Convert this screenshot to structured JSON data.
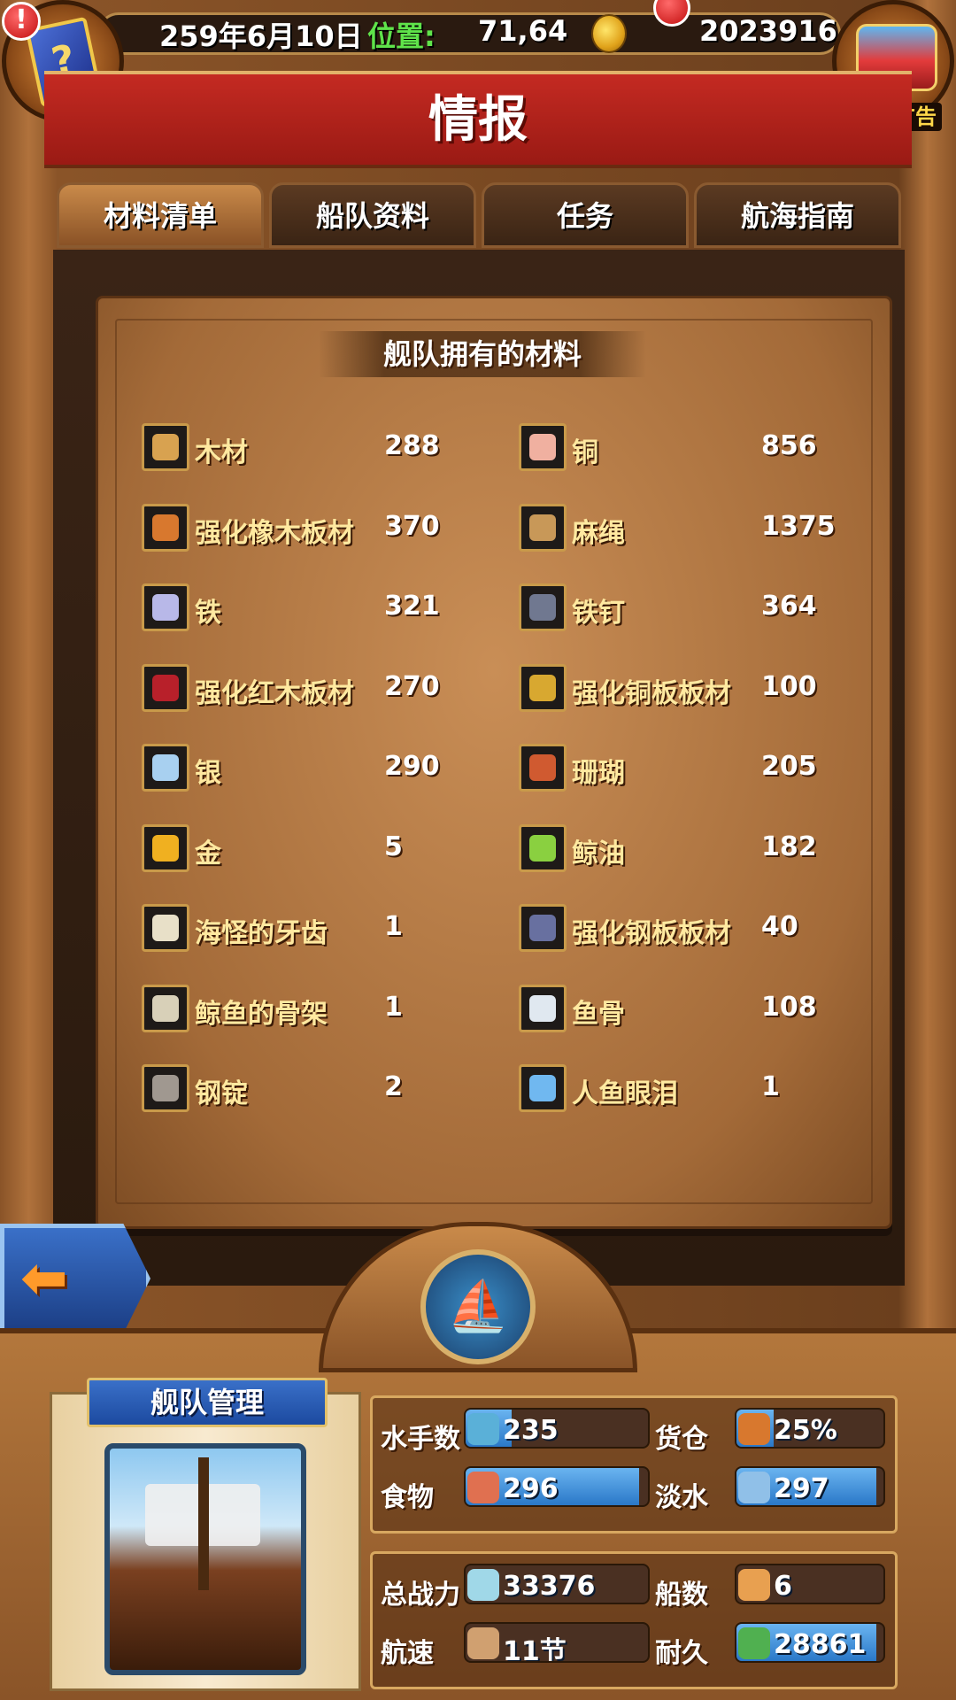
{
  "header": {
    "date": "259年6月10日",
    "position_label": "位置:",
    "position_value": "71,64",
    "gold": "2023916",
    "ad_label": "有新广告"
  },
  "title": "情报",
  "tabs": [
    {
      "label": "材料清单",
      "active": true
    },
    {
      "label": "船队资料",
      "active": false
    },
    {
      "label": "任务",
      "active": false,
      "notification": true
    },
    {
      "label": "航海指南",
      "active": false
    }
  ],
  "section_title": "舰队拥有的材料",
  "materials_left": [
    {
      "name": "木材",
      "qty": "288",
      "icon": "wood-icon",
      "color": "#d8a250"
    },
    {
      "name": "强化橡木板材",
      "qty": "370",
      "icon": "oak-plank-icon",
      "color": "#d8782e"
    },
    {
      "name": "铁",
      "qty": "321",
      "icon": "iron-icon",
      "color": "#b8b8e8"
    },
    {
      "name": "强化红木板材",
      "qty": "270",
      "icon": "mahogany-plank-icon",
      "color": "#b8202a"
    },
    {
      "name": "银",
      "qty": "290",
      "icon": "silver-icon",
      "color": "#a8d0f0"
    },
    {
      "name": "金",
      "qty": "5",
      "icon": "gold-icon",
      "color": "#f0b020"
    },
    {
      "name": "海怪的牙齿",
      "qty": "1",
      "icon": "sea-monster-tooth-icon",
      "color": "#e8e0c8"
    },
    {
      "name": "鲸鱼的骨架",
      "qty": "1",
      "icon": "whale-skeleton-icon",
      "color": "#d8d0b8"
    },
    {
      "name": "钢锭",
      "qty": "2",
      "icon": "steel-ingot-icon",
      "color": "#a09890"
    }
  ],
  "materials_right": [
    {
      "name": "铜",
      "qty": "856",
      "icon": "copper-icon",
      "color": "#f0b0a0"
    },
    {
      "name": "麻绳",
      "qty": "1375",
      "icon": "rope-icon",
      "color": "#c89858"
    },
    {
      "name": "铁钉",
      "qty": "364",
      "icon": "iron-nail-icon",
      "color": "#707890"
    },
    {
      "name": "强化铜板板材",
      "qty": "100",
      "icon": "copper-plate-icon",
      "color": "#d8a830"
    },
    {
      "name": "珊瑚",
      "qty": "205",
      "icon": "coral-icon",
      "color": "#d05a30"
    },
    {
      "name": "鲸油",
      "qty": "182",
      "icon": "whale-oil-icon",
      "color": "#8ad040"
    },
    {
      "name": "强化钢板板材",
      "qty": "40",
      "icon": "steel-plate-icon",
      "color": "#6870a0"
    },
    {
      "name": "鱼骨",
      "qty": "108",
      "icon": "fish-bone-icon",
      "color": "#e0e8f0"
    },
    {
      "name": "人鱼眼泪",
      "qty": "1",
      "icon": "mermaid-tear-icon",
      "color": "#70b8f0"
    }
  ],
  "fleet": {
    "title": "舰队管理",
    "stats_top": [
      {
        "label": "水手数",
        "value": "235",
        "fill": 0.25,
        "icon": "sailor-icon",
        "color": "#5ab0d8"
      },
      {
        "label": "货仓",
        "value": "25%",
        "fill": 0.25,
        "icon": "cargo-icon",
        "color": "#d8782e"
      },
      {
        "label": "食物",
        "value": "296",
        "fill": 0.95,
        "icon": "meat-icon",
        "color": "#e07050"
      },
      {
        "label": "淡水",
        "value": "297",
        "fill": 0.95,
        "icon": "water-jug-icon",
        "color": "#90c0e8"
      }
    ],
    "stats_bottom": [
      {
        "label": "总战力",
        "value": "33376",
        "fill": 0.0,
        "icon": "crossed-swords-icon",
        "color": "#a0d8e8"
      },
      {
        "label": "船数",
        "value": "6",
        "fill": 0.0,
        "icon": "ship-icon",
        "color": "#e8a050"
      },
      {
        "label": "航速",
        "value": "11节",
        "fill": 0.0,
        "icon": "sail-ship-icon",
        "color": "#d0a070"
      },
      {
        "label": "耐久",
        "value": "28861",
        "fill": 0.95,
        "icon": "repair-icon",
        "color": "#50b050"
      }
    ]
  },
  "colors": {
    "accent_green": "#5fe34a",
    "title_red": "#c42a22",
    "bar_blue": "#2a78c8"
  }
}
